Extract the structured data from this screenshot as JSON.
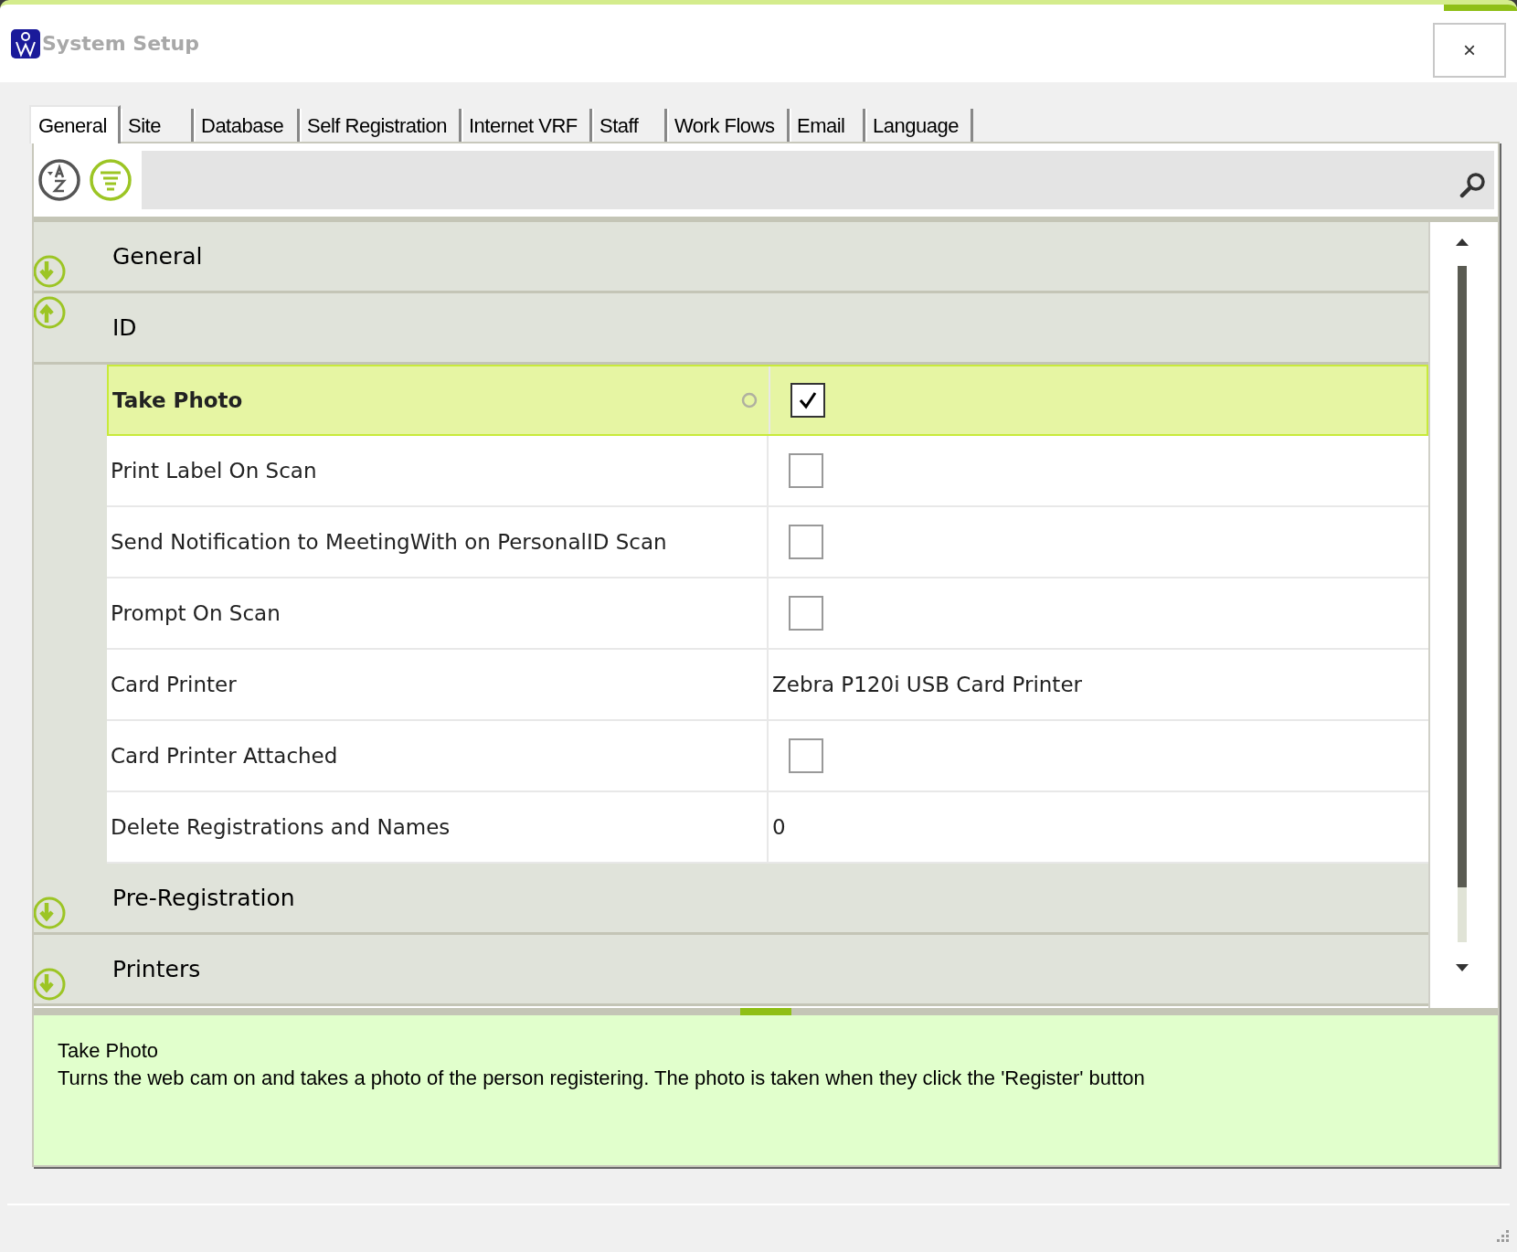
{
  "window": {
    "title": "System Setup",
    "close_button": "×"
  },
  "tabs": [
    {
      "label": "General",
      "selected": true
    },
    {
      "label": "Site",
      "selected": false
    },
    {
      "label": "Database",
      "selected": false
    },
    {
      "label": "Self Registration",
      "selected": false
    },
    {
      "label": "Internet VRF",
      "selected": false
    },
    {
      "label": "Staff",
      "selected": false
    },
    {
      "label": "Work Flows",
      "selected": false
    },
    {
      "label": "Email",
      "selected": false
    },
    {
      "label": "Language",
      "selected": false
    }
  ],
  "view_buttons": [
    {
      "kind": "alphabetical",
      "selected": false
    },
    {
      "kind": "categorized",
      "selected": true
    }
  ],
  "groups": [
    {
      "title": "General",
      "expanded": false
    },
    {
      "title": "ID",
      "expanded": true,
      "properties": [
        {
          "label": "Take Photo",
          "kind": "checkbox",
          "checked": true,
          "selected": true
        },
        {
          "label": "Print Label On Scan",
          "kind": "checkbox",
          "checked": false,
          "selected": false
        },
        {
          "label": "Send Notification to MeetingWith on PersonalID Scan",
          "kind": "checkbox",
          "checked": false,
          "selected": false
        },
        {
          "label": "Prompt On Scan",
          "kind": "checkbox",
          "checked": false,
          "selected": false
        },
        {
          "label": "Card Printer",
          "kind": "text",
          "value": "Zebra P120i USB Card Printer",
          "selected": false
        },
        {
          "label": "Card Printer Attached",
          "kind": "checkbox",
          "checked": false,
          "selected": false
        },
        {
          "label": "Delete Registrations and Names",
          "kind": "text",
          "value": "0",
          "selected": false
        }
      ]
    },
    {
      "title": "Pre-Registration",
      "expanded": false
    },
    {
      "title": "Printers",
      "expanded": false
    }
  ],
  "description": {
    "title": "Take Photo",
    "text": "Turns the web cam on and takes a photo of the person registering. The photo is taken when they click the 'Register' button"
  }
}
